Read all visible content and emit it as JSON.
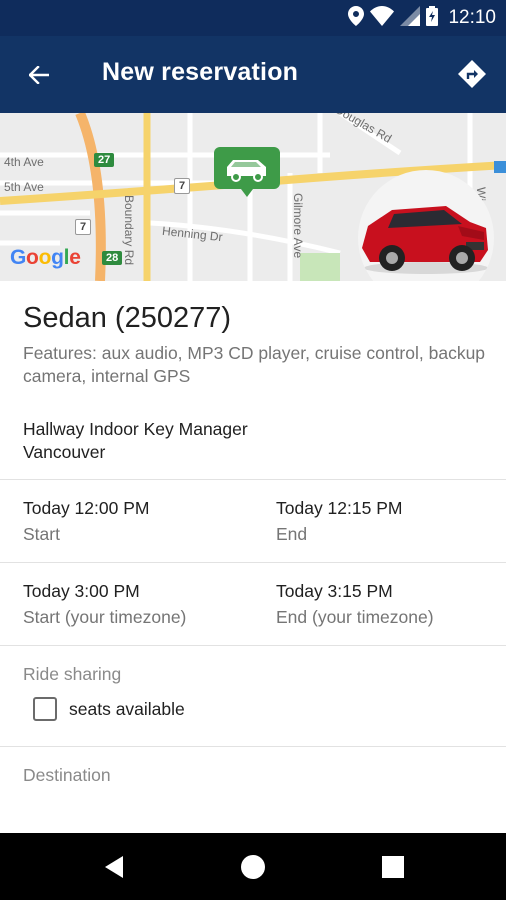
{
  "status_bar": {
    "time": "12:10",
    "icons": [
      "location-icon",
      "wifi-icon",
      "signal-icon",
      "battery-icon"
    ],
    "bg_color": "#0f2c5c"
  },
  "app_bar": {
    "title": "New reservation",
    "back_icon": "arrow-back-icon",
    "action_icon": "directions-icon",
    "bg_color": "#123465"
  },
  "map": {
    "streets": [
      "4th Ave",
      "5th Ave",
      "Boundary Rd",
      "Henning Dr",
      "Gilmore Ave",
      "Douglas Rd",
      "Wi"
    ],
    "route_shields": [
      "27",
      "7",
      "7",
      "28"
    ],
    "attribution": "Google"
  },
  "vehicle": {
    "title": "Sedan (250277)",
    "features": "Features: aux audio, MP3 CD player, cruise control, backup camera, internal GPS",
    "location_name": "Hallway Indoor Key Manager",
    "location_city": "Vancouver"
  },
  "times": {
    "start_value": "Today 12:00 PM",
    "start_label": "Start",
    "end_value": "Today 12:15 PM",
    "end_label": "End",
    "start_local_value": "Today 3:00 PM",
    "start_local_label": "Start (your timezone)",
    "end_local_value": "Today 3:15 PM",
    "end_local_label": "End (your timezone)"
  },
  "ride_sharing": {
    "label": "Ride sharing",
    "checkbox_label": "seats available",
    "checked": false
  },
  "destination": {
    "label": "Destination"
  },
  "nav_bar": {
    "icons": [
      "back-triangle-icon",
      "home-circle-icon",
      "recents-square-icon"
    ]
  }
}
